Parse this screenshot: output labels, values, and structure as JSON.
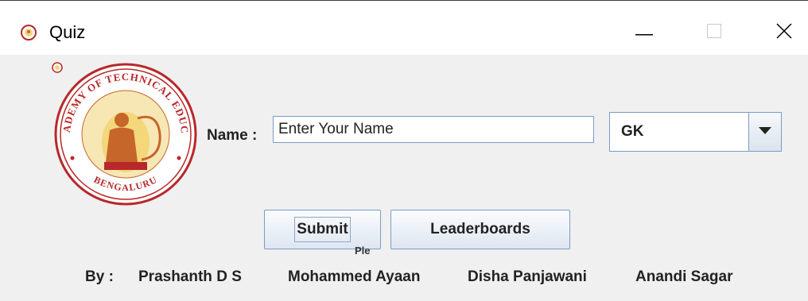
{
  "window": {
    "title": "Quiz",
    "icons": {
      "app": "jss-logo-icon",
      "minimize": "minimize-icon",
      "maximize": "maximize-icon",
      "close": "close-icon"
    }
  },
  "logo": {
    "name": "jss-academy-logo",
    "top_text": "JSS ACADEMY OF TECHNICAL EDUCATION",
    "bottom_text": "BENGALURU",
    "colors": {
      "ring": "#b8282a",
      "inner": "#f3d77a",
      "figure": "#c6662a"
    }
  },
  "form": {
    "name_label": "Name :",
    "name_value": "Enter Your Name",
    "category_value": "GK"
  },
  "buttons": {
    "submit": "Submit",
    "leaderboards": "Leaderboards"
  },
  "overlap_text": "Ple",
  "credits": {
    "by": "By :",
    "authors": [
      "Prashanth D S",
      "Mohammed Ayaan",
      "Disha Panjawani",
      "Anandi Sagar"
    ]
  },
  "colors": {
    "panel": "#f0f0f0",
    "accent_border": "#7a9cc6"
  }
}
